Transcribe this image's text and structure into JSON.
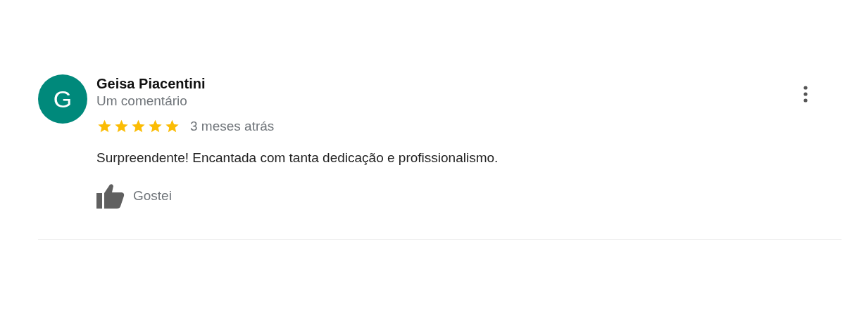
{
  "review": {
    "avatar_letter": "G",
    "author": "Geisa Piacentini",
    "subtitle": "Um comentário",
    "stars": 5,
    "time": "3 meses atrás",
    "text": "Surpreendente! Encantada com tanta dedicação e profissionalismo.",
    "like_label": "Gostei"
  }
}
